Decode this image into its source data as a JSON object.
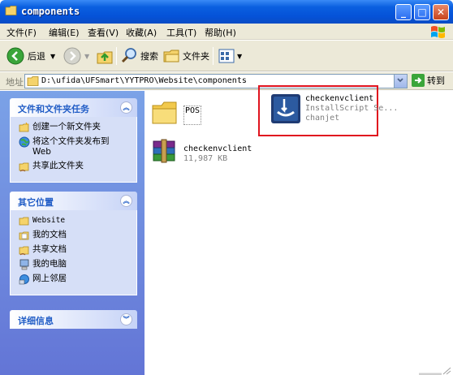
{
  "window": {
    "title": "components"
  },
  "menu": [
    "文件(F)",
    "编辑(E)",
    "查看(V)",
    "收藏(A)",
    "工具(T)",
    "帮助(H)"
  ],
  "toolbar": {
    "back": "后退",
    "search": "搜索",
    "folders": "文件夹"
  },
  "address": {
    "label": "地址",
    "path": "D:\\ufida\\UFSmart\\YYTPRO\\Website\\components",
    "go": "转到"
  },
  "panels": {
    "tasks": {
      "title": "文件和文件夹任务",
      "items": [
        "创建一个新文件夹",
        "将这个文件夹发布到 Web",
        "共享此文件夹"
      ]
    },
    "places": {
      "title": "其它位置",
      "items": [
        "Website",
        "我的文档",
        "共享文档",
        "我的电脑",
        "网上邻居"
      ]
    },
    "details": {
      "title": "详细信息"
    }
  },
  "files": [
    {
      "name": "POS",
      "type": "folder"
    },
    {
      "name": "checkenvclient",
      "line2": "InstallScript Se...",
      "line3": "chanjet",
      "type": "installer"
    },
    {
      "name": "checkenvclient",
      "line2": "11,987 KB",
      "type": "archive"
    }
  ],
  "colors": {
    "title_blue": "#0552d8",
    "highlight": "#e0141e",
    "pane_blue": "#6375d6"
  }
}
